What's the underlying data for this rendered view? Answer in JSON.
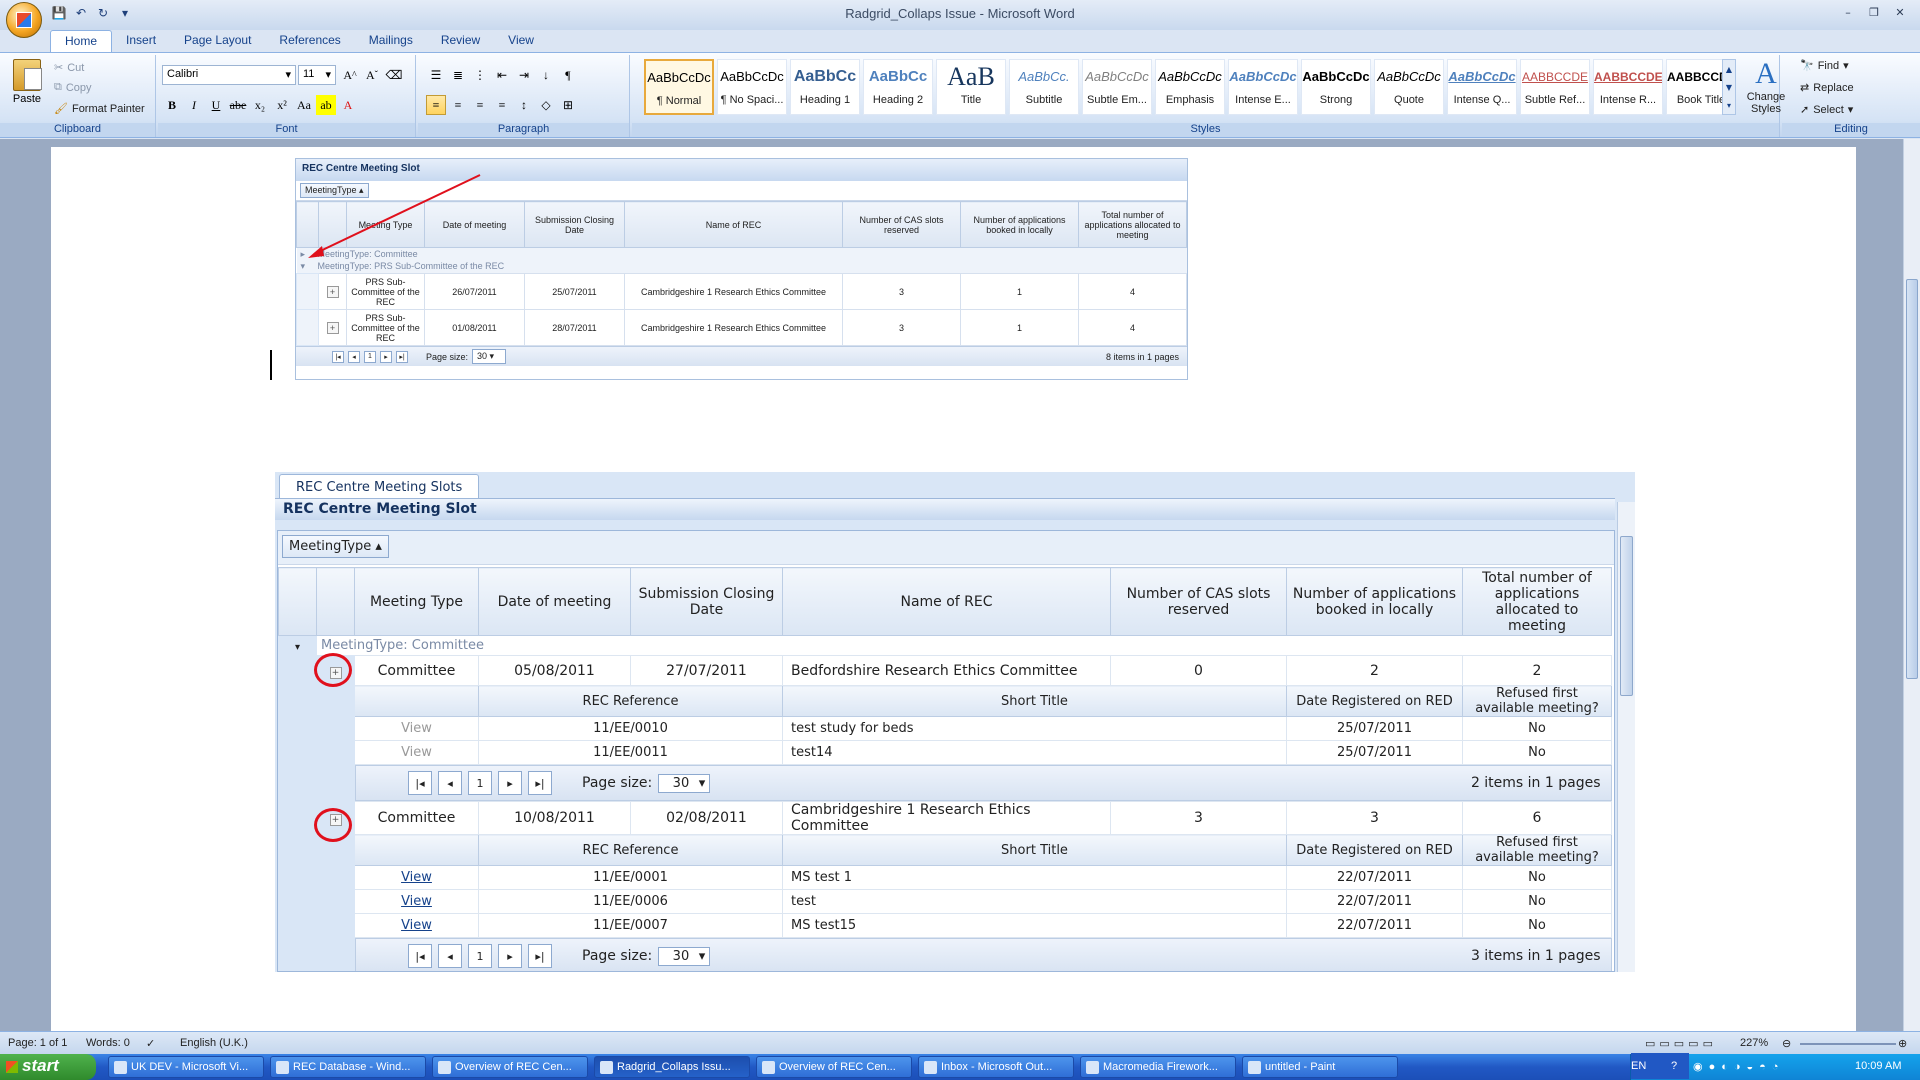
{
  "window": {
    "title": "Radgrid_Collaps Issue - Microsoft Word",
    "controls": [
      "–",
      "❐",
      "✕"
    ]
  },
  "ribbon_tabs": [
    "Home",
    "Insert",
    "Page Layout",
    "References",
    "Mailings",
    "Review",
    "View"
  ],
  "clipboard": {
    "paste": "Paste",
    "cut": "Cut",
    "copy": "Copy",
    "format_painter": "Format Painter",
    "label": "Clipboard"
  },
  "font": {
    "name": "Calibri",
    "size": "11",
    "label": "Font"
  },
  "paragraph": {
    "label": "Paragraph"
  },
  "styles": {
    "label": "Styles",
    "tiles": [
      {
        "sample": "AaBbCcDc",
        "name": "¶ Normal"
      },
      {
        "sample": "AaBbCcDc",
        "name": "¶ No Spaci..."
      },
      {
        "sample": "AaBbCc",
        "name": "Heading 1"
      },
      {
        "sample": "AaBbCc",
        "name": "Heading 2"
      },
      {
        "sample": "AaB",
        "name": "Title"
      },
      {
        "sample": "AaBbCc.",
        "name": "Subtitle"
      },
      {
        "sample": "AaBbCcDc",
        "name": "Subtle Em..."
      },
      {
        "sample": "AaBbCcDc",
        "name": "Emphasis"
      },
      {
        "sample": "AaBbCcDc",
        "name": "Intense E..."
      },
      {
        "sample": "AaBbCcDc",
        "name": "Strong"
      },
      {
        "sample": "AaBbCcDc",
        "name": "Quote"
      },
      {
        "sample": "AaBbCcDc",
        "name": "Intense Q..."
      },
      {
        "sample": "AABBCCDE",
        "name": "Subtle Ref..."
      },
      {
        "sample": "AABBCCDE",
        "name": "Intense R..."
      },
      {
        "sample": "AABBCCDE",
        "name": "Book Title"
      }
    ],
    "change_styles": "Change Styles"
  },
  "editing": {
    "find": "Find",
    "replace": "Replace",
    "select": "Select",
    "label": "Editing"
  },
  "mini_grid": {
    "title": "REC Centre Meeting Slot",
    "group_chip": "MeetingType",
    "headers": [
      "Meeting Type",
      "Date of meeting",
      "Submission Closing Date",
      "Name of REC",
      "Number of CAS slots reserved",
      "Number of applications booked in locally",
      "Total number of applications allocated to meeting"
    ],
    "group1": "MeetingType: Committee",
    "group2": "MeetingType: PRS Sub-Committee of the REC",
    "rows": [
      [
        "PRS Sub-Committee of the REC",
        "26/07/2011",
        "25/07/2011",
        "Cambridgeshire 1 Research Ethics Committee",
        "3",
        "1",
        "4"
      ],
      [
        "PRS Sub-Committee of the REC",
        "01/08/2011",
        "28/07/2011",
        "Cambridgeshire 1 Research Ethics Committee",
        "3",
        "1",
        "4"
      ]
    ],
    "page": "1",
    "page_size_label": "Page size:",
    "page_size": "30",
    "items": "8 items in 1 pages"
  },
  "big_grid": {
    "tab": "REC Centre Meeting Slots",
    "title": "REC Centre Meeting Slot",
    "group_chip": "MeetingType",
    "headers": [
      "Meeting Type",
      "Date of meeting",
      "Submission Closing Date",
      "Name of REC",
      "Number of CAS slots reserved",
      "Number of applications booked in locally",
      "Total number of applications allocated to meeting"
    ],
    "group1": "MeetingType: Committee",
    "row1": [
      "Committee",
      "05/08/2011",
      "27/07/2011",
      "Bedfordshire Research Ethics Committee",
      "0",
      "2",
      "2"
    ],
    "sub_headers": [
      "REC Reference",
      "Short Title",
      "Date Registered on RED",
      "Refused first available meeting?"
    ],
    "sub1": [
      [
        "View",
        "11/EE/0010",
        "test study for beds",
        "25/07/2011",
        "No"
      ],
      [
        "View",
        "11/EE/0011",
        "test14",
        "25/07/2011",
        "No"
      ]
    ],
    "sub1_items": "2 items in 1 pages",
    "row2": [
      "Committee",
      "10/08/2011",
      "02/08/2011",
      "Cambridgeshire 1 Research Ethics Committee",
      "3",
      "3",
      "6"
    ],
    "sub2": [
      [
        "View",
        "11/EE/0001",
        "MS test 1",
        "22/07/2011",
        "No"
      ],
      [
        "View",
        "11/EE/0006",
        "test",
        "22/07/2011",
        "No"
      ],
      [
        "View",
        "11/EE/0007",
        "MS test15",
        "22/07/2011",
        "No"
      ]
    ],
    "sub2_items": "3 items in 1 pages",
    "page": "1",
    "page_size_label": "Page size:",
    "page_size": "30"
  },
  "status": {
    "page": "Page: 1 of 1",
    "words": "Words: 0",
    "language": "English (U.K.)",
    "zoom": "227%"
  },
  "taskbar": {
    "start": "start",
    "tasks": [
      "UK DEV - Microsoft Vi...",
      "REC Database - Wind...",
      "Overview of REC Cen...",
      "Radgrid_Collaps Issu...",
      "Overview of REC Cen...",
      "Inbox - Microsoft Out...",
      "Macromedia Firework...",
      "untitled - Paint"
    ],
    "lang": "EN",
    "time": "10:09 AM"
  }
}
